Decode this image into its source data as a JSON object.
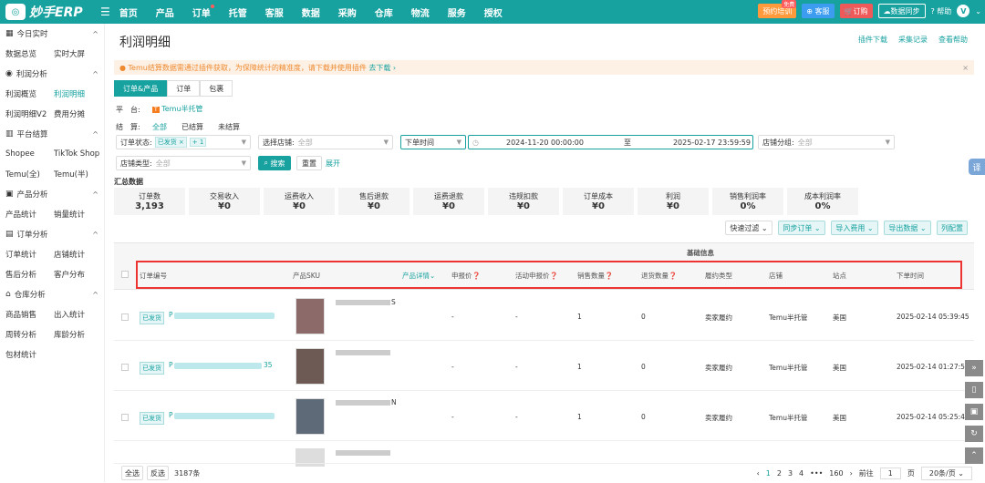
{
  "top": {
    "brand": "妙手ERP",
    "nav": [
      "首页",
      "产品",
      "订单",
      "托管",
      "客服",
      "数据",
      "采购",
      "仓库",
      "物流",
      "服务",
      "授权"
    ],
    "btn1": "预约培训",
    "btn1_badge": "免费",
    "btn2": "客服",
    "btn3": "订购",
    "btn4": "数据同步",
    "help": "帮助",
    "user": "V"
  },
  "side": {
    "s1": "今日实时",
    "r1": [
      "数据总览",
      "实时大屏"
    ],
    "s2": "利润分析",
    "r2": [
      "利润概览",
      "利润明细"
    ],
    "r2b": [
      "利润明细V2",
      "费用分摊"
    ],
    "s3": "平台结算",
    "r3": [
      "Shopee",
      "TikTok Shop"
    ],
    "r3b": [
      "Temu(全)",
      "Temu(半)"
    ],
    "s4": "产品分析",
    "r4": [
      "产品统计",
      "销量统计"
    ],
    "s5": "订单分析",
    "r5": [
      "订单统计",
      "店铺统计"
    ],
    "r5b": [
      "售后分析",
      "客户分布"
    ],
    "s6": "仓库分析",
    "r6": [
      "商品销售",
      "出入统计"
    ],
    "r6b": [
      "周转分析",
      "库龄分析"
    ],
    "r6c": "包材统计"
  },
  "page": {
    "title": "利润明细",
    "links": [
      "插件下载",
      "采集记录",
      "查看帮助"
    ],
    "alert": "Temu结算数据需通过插件获取，为保障统计的精准度，请下载并使用插件",
    "alert_link": "去下载 ›",
    "tabs": [
      "订单&产品",
      "订单",
      "包裹"
    ],
    "platform_label": "平　台:",
    "platform_value": "Temu半托管",
    "settle_label": "结　算:",
    "settle_opts": [
      "全部",
      "已结算",
      "未结算"
    ],
    "order_status_label": "订单状态:",
    "order_status_tag": "已发货 ×",
    "order_status_more": "+ 1",
    "store_label": "选择店铺:",
    "store_ph": "全部",
    "time_type": "下单时间",
    "date_from": "2024-11-20 00:00:00",
    "date_to": "2025-02-17 23:59:59",
    "date_sep": "至",
    "group_label": "店铺分组:",
    "group_ph": "全部",
    "store_type_label": "店铺类型:",
    "store_type_ph": "全部",
    "search": "搜索",
    "reset": "重置",
    "expand": "展开",
    "summary_title": "汇总数据",
    "cards": [
      [
        "订单数",
        "3,193"
      ],
      [
        "交易收入",
        "¥0"
      ],
      [
        "运费收入",
        "¥0"
      ],
      [
        "售后退款",
        "¥0"
      ],
      [
        "运费退款",
        "¥0"
      ],
      [
        "违规扣款",
        "¥0"
      ],
      [
        "订单成本",
        "¥0"
      ],
      [
        "利润",
        "¥0"
      ],
      [
        "销售利润率",
        "0%"
      ],
      [
        "成本利润率",
        "0%"
      ]
    ],
    "actions": [
      "快速过滤",
      "同步订单",
      "导入费用",
      "导出数据",
      "列配置"
    ]
  },
  "table": {
    "group": "基础信息",
    "cols": [
      "订单编号",
      "产品SKU",
      "产品详情",
      "申报价",
      "活动申报价",
      "销售数量",
      "退货数量",
      "履约类型",
      "店铺",
      "站点",
      "下单时间"
    ],
    "rows": [
      {
        "status": "已发货",
        "prefix": "P",
        "suffix": "",
        "sku_suffix": "S",
        "declared": "-",
        "act": "-",
        "qty": "1",
        "ret": "0",
        "type": "卖家履约",
        "store": "Temu半托管",
        "site": "美国",
        "time": "2025-02-14 05:39:45"
      },
      {
        "status": "已发货",
        "prefix": "P",
        "suffix": "35",
        "sku_suffix": "",
        "declared": "-",
        "act": "-",
        "qty": "1",
        "ret": "0",
        "type": "卖家履约",
        "store": "Temu半托管",
        "site": "美国",
        "time": "2025-02-14 01:27:55"
      },
      {
        "status": "已发货",
        "prefix": "P",
        "suffix": "",
        "sku_suffix": "N",
        "declared": "-",
        "act": "-",
        "qty": "1",
        "ret": "0",
        "type": "卖家履约",
        "store": "Temu半托管",
        "site": "美国",
        "time": "2025-02-14 05:25:47"
      }
    ]
  },
  "footer": {
    "all": "全选",
    "invert": "反选",
    "count": "3187条",
    "pages": [
      "1",
      "2",
      "3",
      "4",
      "•••",
      "160"
    ],
    "goto": "前往",
    "page_no": "1",
    "page_unit": "页",
    "per_page": "20条/页"
  }
}
